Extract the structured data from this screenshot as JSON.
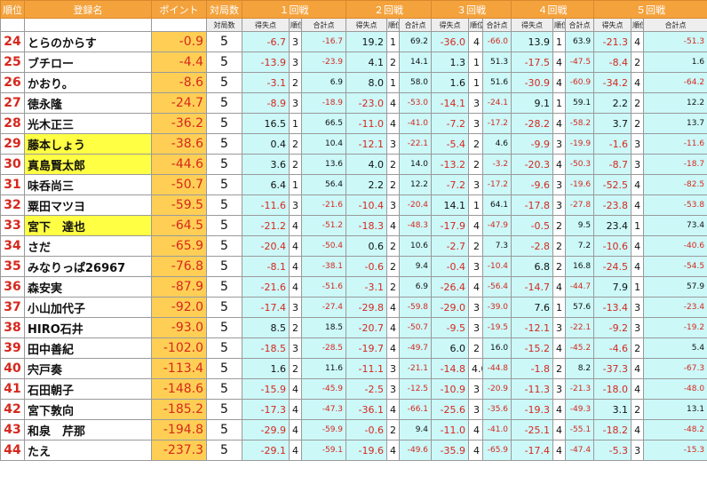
{
  "headers": {
    "rank": "順位",
    "name": "登録名",
    "points": "ポイント",
    "games": "対局数",
    "rounds": [
      "１回戦",
      "２回戦",
      "３回戦",
      "４回戦",
      "５回戦"
    ],
    "sub_games": "対局数",
    "sub_gain": "得失点",
    "sub_place": "順位",
    "sub_total": "合計点"
  },
  "colors": {
    "header_orange": "#f4a23c",
    "points_bg": "#ffcf55",
    "highlight_yellow": "#ffff44",
    "cell_cyan": "#ccf8f8",
    "negative_red": "#d6281e"
  },
  "rows": [
    {
      "rank": "24",
      "name": "とらのからす",
      "points": "-0.9",
      "games": "5",
      "highlight": false,
      "rounds": [
        {
          "gain": "-6.7",
          "place": "3",
          "total": "-16.7"
        },
        {
          "gain": "19.2",
          "place": "1",
          "total": "69.2"
        },
        {
          "gain": "-36.0",
          "place": "4",
          "total": "-66.0"
        },
        {
          "gain": "13.9",
          "place": "1",
          "total": "63.9"
        },
        {
          "gain": "-21.3",
          "place": "4",
          "total": "-51.3"
        }
      ]
    },
    {
      "rank": "25",
      "name": "ブチロー",
      "points": "-4.4",
      "games": "5",
      "highlight": false,
      "rounds": [
        {
          "gain": "-13.9",
          "place": "3",
          "total": "-23.9"
        },
        {
          "gain": "4.1",
          "place": "2",
          "total": "14.1"
        },
        {
          "gain": "1.3",
          "place": "1",
          "total": "51.3"
        },
        {
          "gain": "-17.5",
          "place": "4",
          "total": "-47.5"
        },
        {
          "gain": "-8.4",
          "place": "2",
          "total": "1.6"
        }
      ]
    },
    {
      "rank": "26",
      "name": "かおり。",
      "points": "-8.6",
      "games": "5",
      "highlight": false,
      "rounds": [
        {
          "gain": "-3.1",
          "place": "2",
          "total": "6.9"
        },
        {
          "gain": "8.0",
          "place": "1",
          "total": "58.0"
        },
        {
          "gain": "1.6",
          "place": "1",
          "total": "51.6"
        },
        {
          "gain": "-30.9",
          "place": "4",
          "total": "-60.9"
        },
        {
          "gain": "-34.2",
          "place": "4",
          "total": "-64.2"
        }
      ]
    },
    {
      "rank": "27",
      "name": "徳永隆",
      "points": "-24.7",
      "games": "5",
      "highlight": false,
      "rounds": [
        {
          "gain": "-8.9",
          "place": "3",
          "total": "-18.9"
        },
        {
          "gain": "-23.0",
          "place": "4",
          "total": "-53.0"
        },
        {
          "gain": "-14.1",
          "place": "3",
          "total": "-24.1"
        },
        {
          "gain": "9.1",
          "place": "1",
          "total": "59.1"
        },
        {
          "gain": "2.2",
          "place": "2",
          "total": "12.2"
        }
      ]
    },
    {
      "rank": "28",
      "name": "光木正三",
      "points": "-36.2",
      "games": "5",
      "highlight": false,
      "rounds": [
        {
          "gain": "16.5",
          "place": "1",
          "total": "66.5"
        },
        {
          "gain": "-11.0",
          "place": "4",
          "total": "-41.0"
        },
        {
          "gain": "-7.2",
          "place": "3",
          "total": "-17.2"
        },
        {
          "gain": "-28.2",
          "place": "4",
          "total": "-58.2"
        },
        {
          "gain": "3.7",
          "place": "2",
          "total": "13.7"
        }
      ]
    },
    {
      "rank": "29",
      "name": "藤本しょう",
      "points": "-38.6",
      "games": "5",
      "highlight": true,
      "rounds": [
        {
          "gain": "0.4",
          "place": "2",
          "total": "10.4"
        },
        {
          "gain": "-12.1",
          "place": "3",
          "total": "-22.1"
        },
        {
          "gain": "-5.4",
          "place": "2",
          "total": "4.6"
        },
        {
          "gain": "-9.9",
          "place": "3",
          "total": "-19.9"
        },
        {
          "gain": "-1.6",
          "place": "3",
          "total": "-11.6"
        }
      ]
    },
    {
      "rank": "30",
      "name": "真島賢太郎",
      "points": "-44.6",
      "games": "5",
      "highlight": true,
      "rounds": [
        {
          "gain": "3.6",
          "place": "2",
          "total": "13.6"
        },
        {
          "gain": "4.0",
          "place": "2",
          "total": "14.0"
        },
        {
          "gain": "-13.2",
          "place": "2",
          "total": "-3.2"
        },
        {
          "gain": "-20.3",
          "place": "4",
          "total": "-50.3"
        },
        {
          "gain": "-8.7",
          "place": "3",
          "total": "-18.7"
        }
      ]
    },
    {
      "rank": "31",
      "name": "味呑尚三",
      "points": "-50.7",
      "games": "5",
      "highlight": false,
      "rounds": [
        {
          "gain": "6.4",
          "place": "1",
          "total": "56.4"
        },
        {
          "gain": "2.2",
          "place": "2",
          "total": "12.2"
        },
        {
          "gain": "-7.2",
          "place": "3",
          "total": "-17.2"
        },
        {
          "gain": "-9.6",
          "place": "3",
          "total": "-19.6"
        },
        {
          "gain": "-52.5",
          "place": "4",
          "total": "-82.5"
        }
      ]
    },
    {
      "rank": "32",
      "name": "粟田マツヨ",
      "points": "-59.5",
      "games": "5",
      "highlight": false,
      "rounds": [
        {
          "gain": "-11.6",
          "place": "3",
          "total": "-21.6"
        },
        {
          "gain": "-10.4",
          "place": "3",
          "total": "-20.4"
        },
        {
          "gain": "14.1",
          "place": "1",
          "total": "64.1"
        },
        {
          "gain": "-17.8",
          "place": "3",
          "total": "-27.8"
        },
        {
          "gain": "-23.8",
          "place": "4",
          "total": "-53.8"
        }
      ]
    },
    {
      "rank": "33",
      "name": "宮下　達也",
      "points": "-64.5",
      "games": "5",
      "highlight": true,
      "rounds": [
        {
          "gain": "-21.2",
          "place": "4",
          "total": "-51.2"
        },
        {
          "gain": "-18.3",
          "place": "4",
          "total": "-48.3"
        },
        {
          "gain": "-17.9",
          "place": "4",
          "total": "-47.9"
        },
        {
          "gain": "-0.5",
          "place": "2",
          "total": "9.5"
        },
        {
          "gain": "23.4",
          "place": "1",
          "total": "73.4"
        }
      ]
    },
    {
      "rank": "34",
      "name": "さだ",
      "points": "-65.9",
      "games": "5",
      "highlight": false,
      "rounds": [
        {
          "gain": "-20.4",
          "place": "4",
          "total": "-50.4"
        },
        {
          "gain": "0.6",
          "place": "2",
          "total": "10.6"
        },
        {
          "gain": "-2.7",
          "place": "2",
          "total": "7.3"
        },
        {
          "gain": "-2.8",
          "place": "2",
          "total": "7.2"
        },
        {
          "gain": "-10.6",
          "place": "4",
          "total": "-40.6"
        }
      ]
    },
    {
      "rank": "35",
      "name": "みなりっぱ26967",
      "points": "-76.8",
      "games": "5",
      "highlight": false,
      "rounds": [
        {
          "gain": "-8.1",
          "place": "4",
          "total": "-38.1"
        },
        {
          "gain": "-0.6",
          "place": "2",
          "total": "9.4"
        },
        {
          "gain": "-0.4",
          "place": "3",
          "total": "-10.4"
        },
        {
          "gain": "6.8",
          "place": "2",
          "total": "16.8"
        },
        {
          "gain": "-24.5",
          "place": "4",
          "total": "-54.5"
        }
      ]
    },
    {
      "rank": "36",
      "name": "森安実",
      "points": "-87.9",
      "games": "5",
      "highlight": false,
      "rounds": [
        {
          "gain": "-21.6",
          "place": "4",
          "total": "-51.6"
        },
        {
          "gain": "-3.1",
          "place": "2",
          "total": "6.9"
        },
        {
          "gain": "-26.4",
          "place": "4",
          "total": "-56.4"
        },
        {
          "gain": "-14.7",
          "place": "4",
          "total": "-44.7"
        },
        {
          "gain": "7.9",
          "place": "1",
          "total": "57.9"
        }
      ]
    },
    {
      "rank": "37",
      "name": "小山加代子",
      "points": "-92.0",
      "games": "5",
      "highlight": false,
      "rounds": [
        {
          "gain": "-17.4",
          "place": "3",
          "total": "-27.4"
        },
        {
          "gain": "-29.8",
          "place": "4",
          "total": "-59.8"
        },
        {
          "gain": "-29.0",
          "place": "3",
          "total": "-39.0"
        },
        {
          "gain": "7.6",
          "place": "1",
          "total": "57.6"
        },
        {
          "gain": "-13.4",
          "place": "3",
          "total": "-23.4"
        }
      ]
    },
    {
      "rank": "38",
      "name": "HIRO石井",
      "points": "-93.0",
      "games": "5",
      "highlight": false,
      "rounds": [
        {
          "gain": "8.5",
          "place": "2",
          "total": "18.5"
        },
        {
          "gain": "-20.7",
          "place": "4",
          "total": "-50.7"
        },
        {
          "gain": "-9.5",
          "place": "3",
          "total": "-19.5"
        },
        {
          "gain": "-12.1",
          "place": "3",
          "total": "-22.1"
        },
        {
          "gain": "-9.2",
          "place": "3",
          "total": "-19.2"
        }
      ]
    },
    {
      "rank": "39",
      "name": "田中善紀",
      "points": "-102.0",
      "games": "5",
      "highlight": false,
      "rounds": [
        {
          "gain": "-18.5",
          "place": "3",
          "total": "-28.5"
        },
        {
          "gain": "-19.7",
          "place": "4",
          "total": "-49.7"
        },
        {
          "gain": "6.0",
          "place": "2",
          "total": "16.0"
        },
        {
          "gain": "-15.2",
          "place": "4",
          "total": "-45.2"
        },
        {
          "gain": "-4.6",
          "place": "2",
          "total": "5.4"
        }
      ]
    },
    {
      "rank": "40",
      "name": "宍戸奏",
      "points": "-113.4",
      "games": "5",
      "highlight": false,
      "rounds": [
        {
          "gain": "1.6",
          "place": "2",
          "total": "11.6"
        },
        {
          "gain": "-11.1",
          "place": "3",
          "total": "-21.1"
        },
        {
          "gain": "-14.8",
          "place": "4.0",
          "total": "-44.8"
        },
        {
          "gain": "-1.8",
          "place": "2",
          "total": "8.2"
        },
        {
          "gain": "-37.3",
          "place": "4",
          "total": "-67.3"
        }
      ]
    },
    {
      "rank": "41",
      "name": "石田朝子",
      "points": "-148.6",
      "games": "5",
      "highlight": false,
      "rounds": [
        {
          "gain": "-15.9",
          "place": "4",
          "total": "-45.9"
        },
        {
          "gain": "-2.5",
          "place": "3",
          "total": "-12.5"
        },
        {
          "gain": "-10.9",
          "place": "3",
          "total": "-20.9"
        },
        {
          "gain": "-11.3",
          "place": "3",
          "total": "-21.3"
        },
        {
          "gain": "-18.0",
          "place": "4",
          "total": "-48.0"
        }
      ]
    },
    {
      "rank": "42",
      "name": "宮下敦向",
      "points": "-185.2",
      "games": "5",
      "highlight": false,
      "rounds": [
        {
          "gain": "-17.3",
          "place": "4",
          "total": "-47.3"
        },
        {
          "gain": "-36.1",
          "place": "4",
          "total": "-66.1"
        },
        {
          "gain": "-25.6",
          "place": "3",
          "total": "-35.6"
        },
        {
          "gain": "-19.3",
          "place": "4",
          "total": "-49.3"
        },
        {
          "gain": "3.1",
          "place": "2",
          "total": "13.1"
        }
      ]
    },
    {
      "rank": "43",
      "name": "和泉　芹那",
      "points": "-194.8",
      "games": "5",
      "highlight": false,
      "rounds": [
        {
          "gain": "-29.9",
          "place": "4",
          "total": "-59.9"
        },
        {
          "gain": "-0.6",
          "place": "2",
          "total": "9.4"
        },
        {
          "gain": "-11.0",
          "place": "4",
          "total": "-41.0"
        },
        {
          "gain": "-25.1",
          "place": "4",
          "total": "-55.1"
        },
        {
          "gain": "-18.2",
          "place": "4",
          "total": "-48.2"
        }
      ]
    },
    {
      "rank": "44",
      "name": "たえ",
      "points": "-237.3",
      "games": "5",
      "highlight": false,
      "rounds": [
        {
          "gain": "-29.1",
          "place": "4",
          "total": "-59.1"
        },
        {
          "gain": "-19.6",
          "place": "4",
          "total": "-49.6"
        },
        {
          "gain": "-35.9",
          "place": "4",
          "total": "-65.9"
        },
        {
          "gain": "-17.4",
          "place": "4",
          "total": "-47.4"
        },
        {
          "gain": "-5.3",
          "place": "3",
          "total": "-15.3"
        }
      ]
    }
  ]
}
